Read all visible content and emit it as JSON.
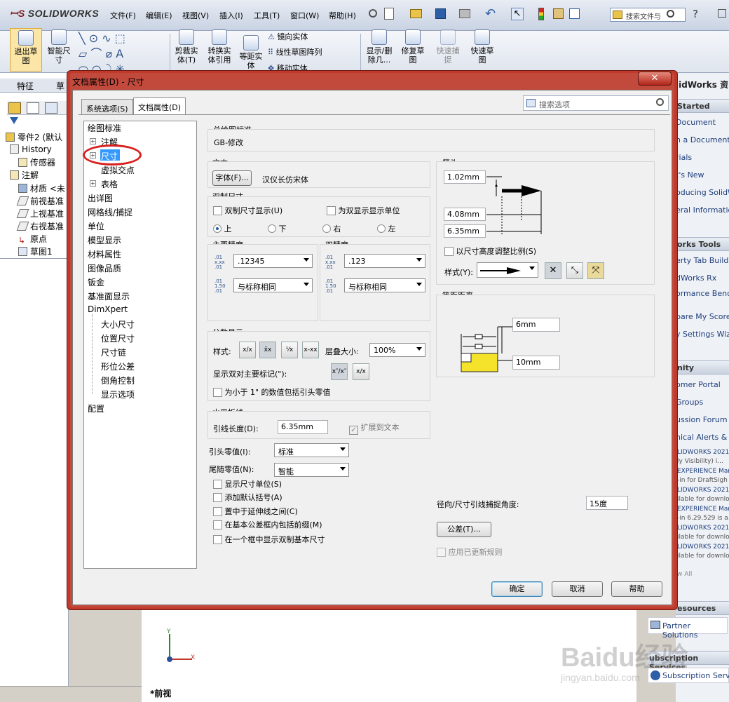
{
  "app": {
    "logo_text": "SOLIDWORKS"
  },
  "menu": [
    "文件(F)",
    "编辑(E)",
    "视图(V)",
    "插入(I)",
    "工具(T)",
    "窗口(W)",
    "帮助(H)"
  ],
  "top_search_placeholder": "搜索文件与",
  "ribbon": {
    "exit_sketch": "退出草\n图",
    "smart_dim": "智能尺\n寸",
    "trim": "剪裁实\n体(T)",
    "convert": "转换实\n体引用",
    "offset": "等距实\n体",
    "mirror": "镜向实体",
    "linear_pattern": "线性草图阵列",
    "move": "移动实体",
    "show_delete": "显示/删\n除几...",
    "repair": "修复草\n图",
    "quick_snap": "快速捕\n捉",
    "rapid_sketch": "快速草\n图"
  },
  "left_panel": {
    "tabs": [
      "特征",
      "草"
    ],
    "tree": [
      "零件2 (默认",
      "History",
      "传感器",
      "注解",
      "材质 <未",
      "前视基准",
      "上视基准",
      "右视基准",
      "原点",
      "草图1"
    ]
  },
  "task_pane": {
    "title": "lidWorks 资",
    "sections": [
      {
        "head": "Started",
        "items": [
          "Document",
          "n a Document",
          "rials",
          "t's New",
          "oducing SolidW",
          "eral Informatio"
        ]
      },
      {
        "head": "orks Tools",
        "items": [
          "erty Tab Build",
          "dWorks Rx",
          "ormance Bench",
          "pare My Score",
          "y Settings Wiza"
        ]
      },
      {
        "head": "nity",
        "items": [
          "omer Portal",
          "Groups",
          "ussion Forum",
          "nical Alerts &"
        ]
      }
    ],
    "news": [
      "LIDWORKS 2021",
      "ly Visibility) i...",
      "EXPERIENCE Mar",
      "-in for DraftSigh",
      "LIDWORKS 2021",
      "ilable for downlo",
      "EXPERIENCE Mar",
      "-in 6.29.529 is a...",
      "LIDWORKS 2021",
      "ilable for downlo",
      "LIDWORKS 2021",
      "ilable for downlo"
    ],
    "view_all": "w All",
    "resources_head": "esources",
    "partner": "Partner Solutions",
    "subs_head": "ubscription Services",
    "subs_item": "Subscription Servic"
  },
  "graphics": {
    "view_label": "*前视",
    "axis_x": "X",
    "axis_y": "Y"
  },
  "watermark": {
    "logo": "Baidu经验",
    "url": "jingyan.baidu.com"
  },
  "dialog": {
    "title": "文档属性(D) - 尺寸",
    "tabs": [
      "系统选项(S)",
      "文档属性(D)"
    ],
    "search_placeholder": "搜索选项",
    "nav": [
      "绘图标准",
      "注解",
      "尺寸",
      "虚拟交点",
      "表格",
      "出详图",
      "网格线/捕捉",
      "单位",
      "模型显示",
      "材料属性",
      "图像品质",
      "钣金",
      "基准面显示",
      "DimXpert",
      "大小尺寸",
      "位置尺寸",
      "尺寸链",
      "形位公差",
      "倒角控制",
      "显示选项",
      "配置"
    ],
    "overall_standard_label": "总绘图标准",
    "overall_standard_value": "GB-修改",
    "text_group": "文本",
    "font_button": "字体(F)...",
    "font_name": "汉仪长仿宋体",
    "dual_group": "双制尺寸",
    "dual_show": "双制尺寸显示(U)",
    "dual_units": "为双显示显示单位",
    "pos_top": "上",
    "pos_bottom": "下",
    "pos_right": "右",
    "pos_left": "左",
    "primary_precision": "主要精度",
    "dual_precision": "双精度",
    "primary_value": ".12345",
    "primary_tol": "与标称相同",
    "dual_value": ".123",
    "dual_tol": "与标称相同",
    "fraction_group": "分数显示",
    "style_label": "样式:",
    "stack_size_label": "层叠大小:",
    "stack_size_value": "100%",
    "show_dual_prime": "显示双对主要标记(\"):",
    "leading_zero_inch": "为小于 1\" 的数值包括引头零值",
    "horiz_break_group": "水平折线",
    "leader_length_label": "引线长度(D):",
    "leader_length_value": "6.35mm",
    "extend_to_text": "扩展到文本",
    "leading_zeros_label": "引头零值(I):",
    "leading_zeros_value": "标准",
    "trailing_zeros_label": "尾随零值(N):",
    "trailing_zeros_value": "智能",
    "show_units": "显示尺寸单位(S)",
    "add_parens": "添加默认括号(A)",
    "center_ext": "置中于延伸线之间(C)",
    "prefix_basic": "在基本公差框内包括前缀(M)",
    "dual_basic": "在一个框中显示双制基本尺寸",
    "arrows_group": "箭头",
    "arrow_v1": "1.02mm",
    "arrow_v2": "4.08mm",
    "arrow_v3": "6.35mm",
    "scale_with_height": "以尺寸高度调整比例(S)",
    "arrow_style_label": "样式(Y):",
    "offset_group": "等距距离",
    "offset_v1": "6mm",
    "offset_v2": "10mm",
    "radial_snap_label": "径向/尺寸引线捕捉角度:",
    "radial_snap_value": "15度",
    "tolerance_button": "公差(T)...",
    "apply_rules": "应用已更新规则",
    "ok": "确定",
    "cancel": "取消",
    "help": "帮助"
  }
}
